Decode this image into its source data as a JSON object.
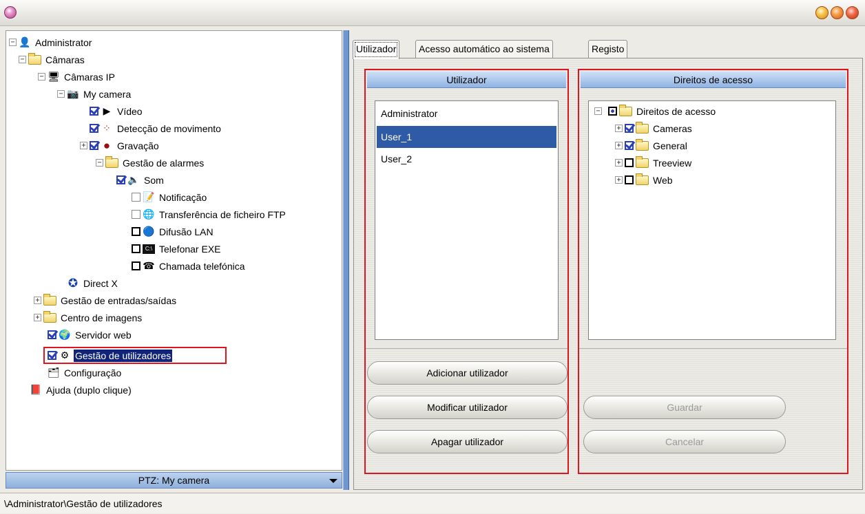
{
  "tree": {
    "root": "Administrator",
    "cameras": "Câmaras",
    "ip_cameras": "Câmaras IP",
    "my_camera": "My camera",
    "video": "Vídeo",
    "motion": "Detecção de movimento",
    "recording": "Gravação",
    "alarm_mgmt": "Gestão de alarmes",
    "sound": "Som",
    "notification": "Notificação",
    "ftp": "Transferência de ficheiro FTP",
    "lan": "Difusão LAN",
    "exe": "Telefonar EXE",
    "phone": "Chamada telefónica",
    "directx": "Direct X",
    "io_mgmt": "Gestão de entradas/saídas",
    "image_center": "Centro de imagens",
    "web_server": "Servidor web",
    "user_mgmt": "Gestão de utilizadores",
    "config": "Configuração",
    "help": "Ajuda (duplo clique)"
  },
  "ptz": {
    "label": "PTZ: My camera"
  },
  "tabs": [
    "Utilizador",
    "Acesso automático ao sistema",
    "Registo"
  ],
  "users_panel": {
    "header": "Utilizador",
    "users": [
      "Administrator",
      "User_1",
      "User_2"
    ],
    "selected_index": 1,
    "add": "Adicionar utilizador",
    "modify": "Modificar utilizador",
    "delete": "Apagar utilizador"
  },
  "rights_panel": {
    "header": "Direitos de acesso",
    "root": "Direitos de acesso",
    "items": [
      "Cameras",
      "General",
      "Treeview",
      "Web"
    ],
    "save": "Guardar",
    "cancel": "Cancelar"
  },
  "status": {
    "path": "\\Administrator\\Gestão de utilizadores"
  },
  "colors": {
    "accent": "#10247a",
    "highlight_box": "#e0141e",
    "header_blue": "#8fb3e3"
  }
}
